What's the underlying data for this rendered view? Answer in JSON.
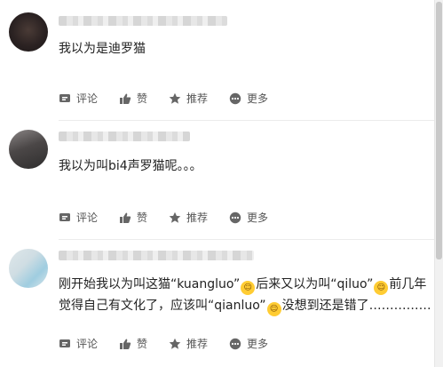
{
  "comments": [
    {
      "text": "我以为是迪罗猫",
      "actions": {
        "comment": "评论",
        "like": "赞",
        "recommend": "推荐",
        "more": "更多"
      }
    },
    {
      "text": "我以为叫bi4声罗猫呢。。。",
      "actions": {
        "comment": "评论",
        "like": "赞",
        "recommend": "推荐",
        "more": "更多"
      }
    },
    {
      "text_parts": [
        "刚开始我以为叫这猫“kuangluo”",
        "后来又以为叫“qiluo”",
        "前几年觉得自己有文化了，应该叫“qianluo”",
        "没想到还是错了……………"
      ],
      "actions": {
        "comment": "评论",
        "like": "赞",
        "recommend": "推荐",
        "more": "更多"
      }
    }
  ],
  "icons": {
    "comment": "comment-icon",
    "like": "thumbs-up-icon",
    "recommend": "star-icon",
    "more": "more-icon",
    "emoji": "laughing-emoji-icon"
  },
  "colors": {
    "text": "#222222",
    "action_text": "#555555",
    "icon": "#666666",
    "emoji": "#ffcc33"
  }
}
